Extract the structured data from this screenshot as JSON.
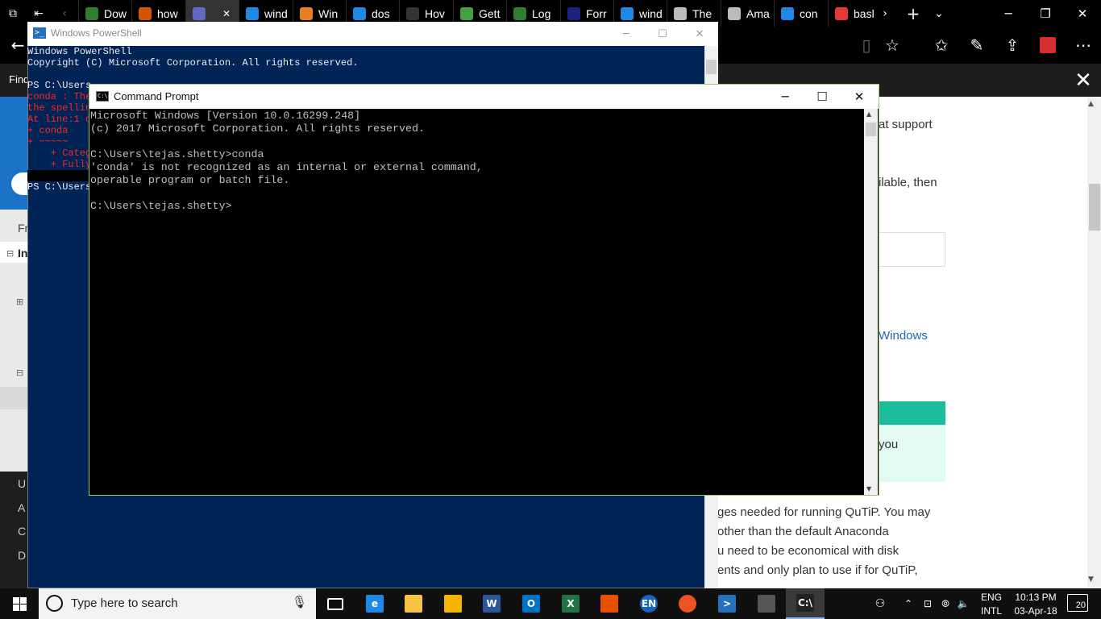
{
  "browser": {
    "tabs": [
      {
        "label": "Dow",
        "icon": "circle-outline-icon",
        "color": "#2e7d32"
      },
      {
        "label": "how",
        "icon": "scale-icon",
        "color": "#d35400"
      },
      {
        "label": "",
        "icon": "wave-icon",
        "color": "#5c6bc0"
      },
      {
        "label": "wind",
        "icon": "bing-icon",
        "color": "#1e88e5"
      },
      {
        "label": "Win",
        "icon": "v-icon",
        "color": "#e67e22"
      },
      {
        "label": "dos",
        "icon": "bing-icon",
        "color": "#1e88e5"
      },
      {
        "label": "Hov",
        "icon": "htg-icon",
        "color": "#333333"
      },
      {
        "label": "Gett",
        "icon": "anaconda-icon",
        "color": "#43a047"
      },
      {
        "label": "Log",
        "icon": "circle-outline-icon",
        "color": "#2e7d32"
      },
      {
        "label": "Forr",
        "icon": "square-icon",
        "color": "#1a237e"
      },
      {
        "label": "wind",
        "icon": "bing-icon",
        "color": "#1e88e5"
      },
      {
        "label": "The",
        "icon": "amazon-icon",
        "color": "#bbbbbb"
      },
      {
        "label": "Ama",
        "icon": "amazon-icon",
        "color": "#bbbbbb"
      },
      {
        "label": "con",
        "icon": "bing-icon",
        "color": "#1e88e5"
      },
      {
        "label": "basl",
        "icon": "ask-icon",
        "color": "#e53935"
      }
    ],
    "find_label": "Find",
    "left_nav": [
      "Fr",
      "In",
      "U",
      "A",
      "C",
      "D"
    ],
    "page_text": {
      "t1": "at support",
      "t2": "ilable, then",
      "link": "Windows",
      "t3": "you",
      "p1": "ges needed for running QuTiP. You may",
      "p2": " other than the default Anaconda",
      "p3": "u need to be economical with disk",
      "p4": "ents and only plan to use if for QuTiP,"
    }
  },
  "powershell": {
    "title": "Windows PowerShell",
    "header_lines": [
      "Windows PowerShell",
      "Copyright (C) Microsoft Corporation. All rights reserved."
    ],
    "prompt1": "PS C:\\Users",
    "error_lines": [
      "conda : The",
      "the spellin",
      "At line:1 c",
      "+ conda",
      "+ ~~~~~",
      "    + Categ",
      "    + Fully"
    ],
    "prompt2": "PS C:\\Users"
  },
  "cmd": {
    "title": "Command Prompt",
    "text": "Microsoft Windows [Version 10.0.16299.248]\n(c) 2017 Microsoft Corporation. All rights reserved.\n\nC:\\Users\\tejas.shetty>conda\n'conda' is not recognized as an internal or external command,\noperable program or batch file.\n\nC:\\Users\\tejas.shetty>"
  },
  "taskbar": {
    "search_placeholder": "Type here to search",
    "apps": [
      {
        "name": "task-view",
        "label": "",
        "color": "#101010"
      },
      {
        "name": "edge",
        "label": "e",
        "color": "#1e88e5"
      },
      {
        "name": "file-explorer",
        "label": "",
        "color": "#f6c342"
      },
      {
        "name": "store",
        "label": "",
        "color": "#f4b400"
      },
      {
        "name": "word",
        "label": "W",
        "color": "#2b579a"
      },
      {
        "name": "outlook",
        "label": "O",
        "color": "#0072c6"
      },
      {
        "name": "excel",
        "label": "X",
        "color": "#217346"
      },
      {
        "name": "matlab",
        "label": "",
        "color": "#e65100"
      },
      {
        "name": "language",
        "label": "EN",
        "color": "#1565c0"
      },
      {
        "name": "ubuntu",
        "label": "",
        "color": "#e95420"
      },
      {
        "name": "powershell",
        "label": ">",
        "color": "#2671be"
      },
      {
        "name": "terminal",
        "label": "",
        "color": "#555555"
      },
      {
        "name": "cmd",
        "label": "C:\\",
        "color": "#222222"
      }
    ],
    "lang_top": "ENG",
    "lang_bottom": "INTL",
    "time": "10:13 PM",
    "date": "03-Apr-18",
    "notifications": "20"
  }
}
